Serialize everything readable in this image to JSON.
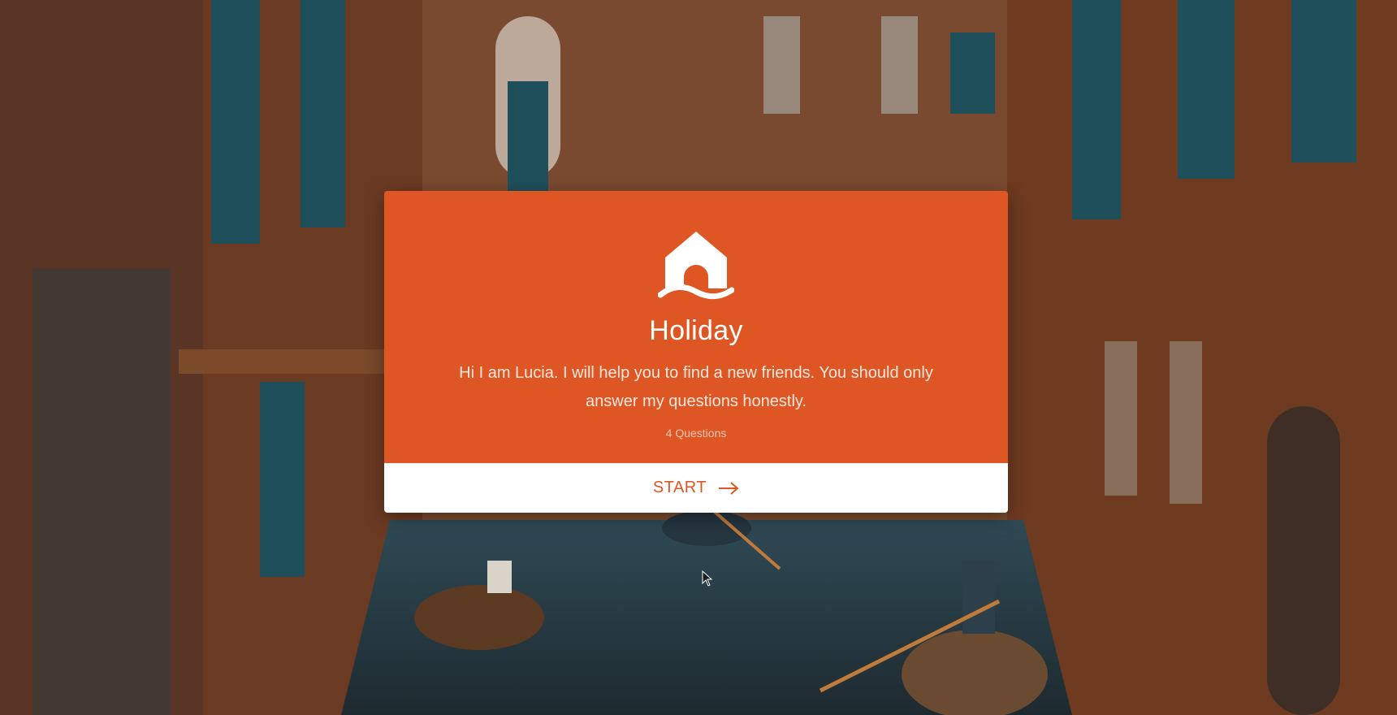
{
  "colors": {
    "accent": "#dd5624",
    "card_bottom": "#ffffff"
  },
  "background": {
    "scene": "venice-canal-photo"
  },
  "card": {
    "logo_icon": "house-on-waves-icon",
    "title": "Holiday",
    "description": "Hi I am Lucia. I will help you to find a new friends. You should only answer my questions honestly.",
    "question_count": "4 Questions",
    "start_label": "START",
    "start_icon": "arrow-right-icon"
  }
}
